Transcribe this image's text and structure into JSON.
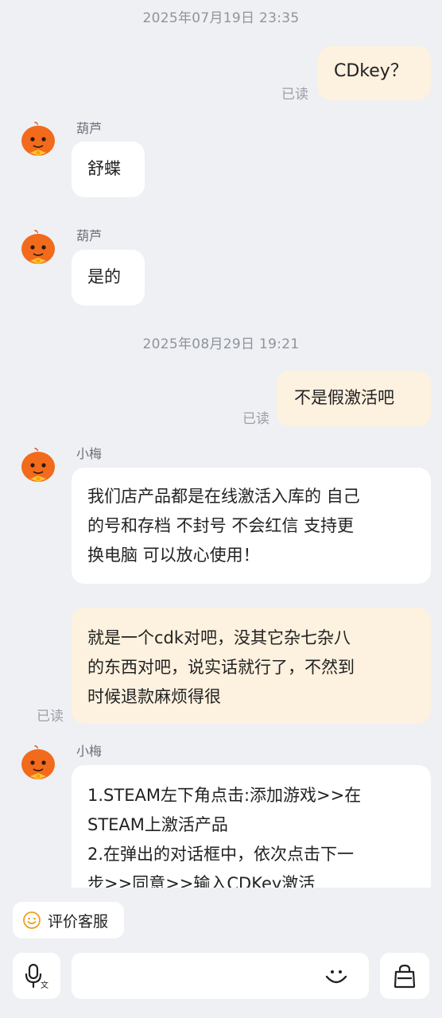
{
  "messages": {
    "ts1": "2025年07月19日 23:35",
    "out1": "CDkey？",
    "read1": "已读",
    "name_hulu": "葫芦",
    "in1": "舒蝶",
    "in2": "是的",
    "ts2": "2025年08月29日 19:21",
    "out2": "不是假激活吧",
    "read2": "已读",
    "name_xiaomei": "小梅",
    "in3_lines": [
      "我们店产品都是在线激活入库的 自己",
      "的号和存档 不封号 不会红信 支持更",
      "换电脑 可以放心使用！"
    ],
    "out3_lines": [
      "就是一个cdk对吧，没其它杂七杂八",
      "的东西对吧，说实话就行了，不然到",
      "时候退款麻烦得很"
    ],
    "read3": "已读",
    "in4_lines": [
      "1.STEAM左下角点击:添加游戏>>在",
      "STEAM上激活产品",
      "2.在弹出的对话框中，依次点击下一",
      "步>>同意>>输入CDKey激活"
    ]
  },
  "bottom": {
    "eval_label": "评价客服"
  },
  "icons": {
    "avatar": "orange-gourd-avatar",
    "eval": "smile-icon",
    "voice": "mic-icon",
    "emoji": "emoji-icon",
    "shop": "shopping-bag-icon"
  },
  "colors": {
    "background": "#eef0f4",
    "incoming_bubble": "#ffffff",
    "outgoing_bubble": "#fdf1df",
    "avatar_orange": "#f26a1b"
  }
}
